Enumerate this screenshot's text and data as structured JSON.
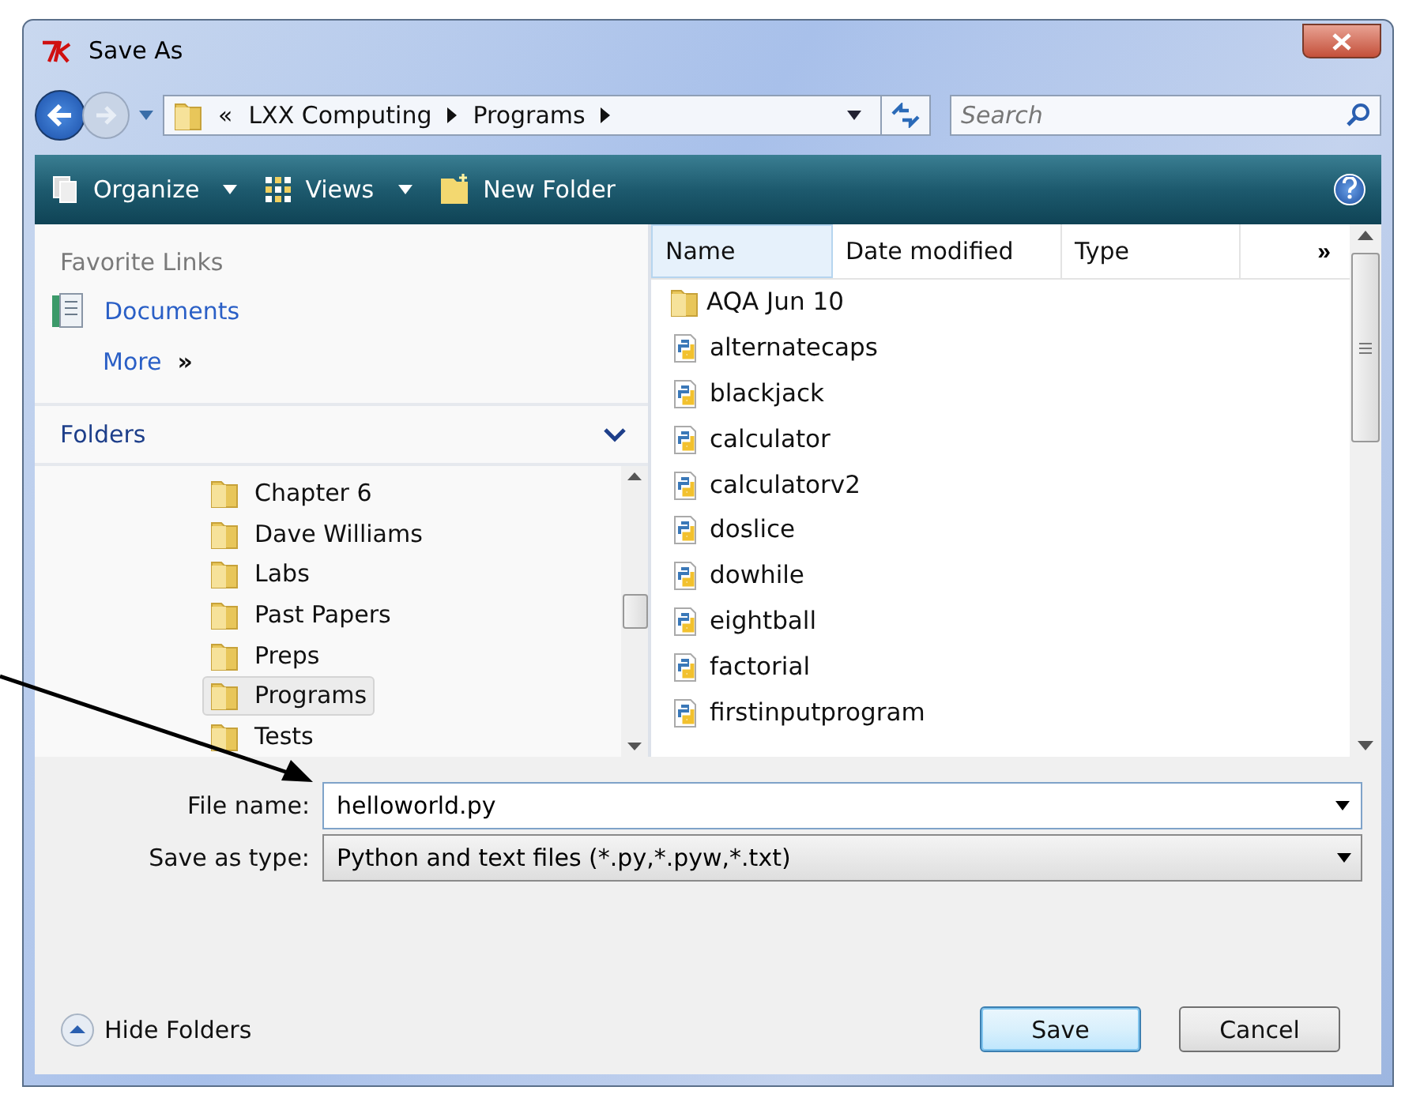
{
  "window": {
    "title": "Save As"
  },
  "nav": {
    "overflow": "«",
    "breadcrumb": [
      "LXX Computing",
      "Programs"
    ],
    "search": {
      "placeholder": "Search"
    }
  },
  "toolbar": [
    {
      "label": "Organize",
      "kind": "menu"
    },
    {
      "label": "Views",
      "kind": "views"
    },
    {
      "label": "New Folder",
      "kind": "newfolder"
    }
  ],
  "favorites": {
    "title": "Favorite Links",
    "items": [
      {
        "label": "Documents",
        "kind": "documents"
      },
      {
        "label": "More",
        "kind": "more",
        "suffix": "»"
      }
    ]
  },
  "folders": {
    "title": "Folders",
    "items": [
      {
        "label": "Chapter 6",
        "selected": false
      },
      {
        "label": "Dave Williams",
        "selected": false
      },
      {
        "label": "Labs",
        "selected": false
      },
      {
        "label": "Past Papers",
        "selected": false
      },
      {
        "label": "Preps",
        "selected": false
      },
      {
        "label": "Programs",
        "selected": true
      },
      {
        "label": "Tests",
        "selected": false
      }
    ]
  },
  "file_list": {
    "columns": [
      "Name",
      "Date modified",
      "Type"
    ],
    "column_overflow": "»",
    "files": [
      {
        "name": "AQA Jun 10",
        "kind": "folder"
      },
      {
        "name": "alternatecaps",
        "kind": "python"
      },
      {
        "name": "blackjack",
        "kind": "python"
      },
      {
        "name": "calculator",
        "kind": "python"
      },
      {
        "name": "calculatorv2",
        "kind": "python"
      },
      {
        "name": "doslice",
        "kind": "python"
      },
      {
        "name": "dowhile",
        "kind": "python"
      },
      {
        "name": "eightball",
        "kind": "python"
      },
      {
        "name": "factorial",
        "kind": "python"
      },
      {
        "name": "firstinputprogram",
        "kind": "python"
      }
    ]
  },
  "form": {
    "file_name": {
      "label": "File name:",
      "value": "helloworld.py"
    },
    "save_as_type": {
      "label": "Save as type:",
      "value": "Python and text files (*.py,*.pyw,*.txt)"
    }
  },
  "footer": {
    "hide_folders": "Hide Folders",
    "buttons": [
      {
        "label": "Save",
        "default": true
      },
      {
        "label": "Cancel",
        "default": false
      }
    ]
  }
}
